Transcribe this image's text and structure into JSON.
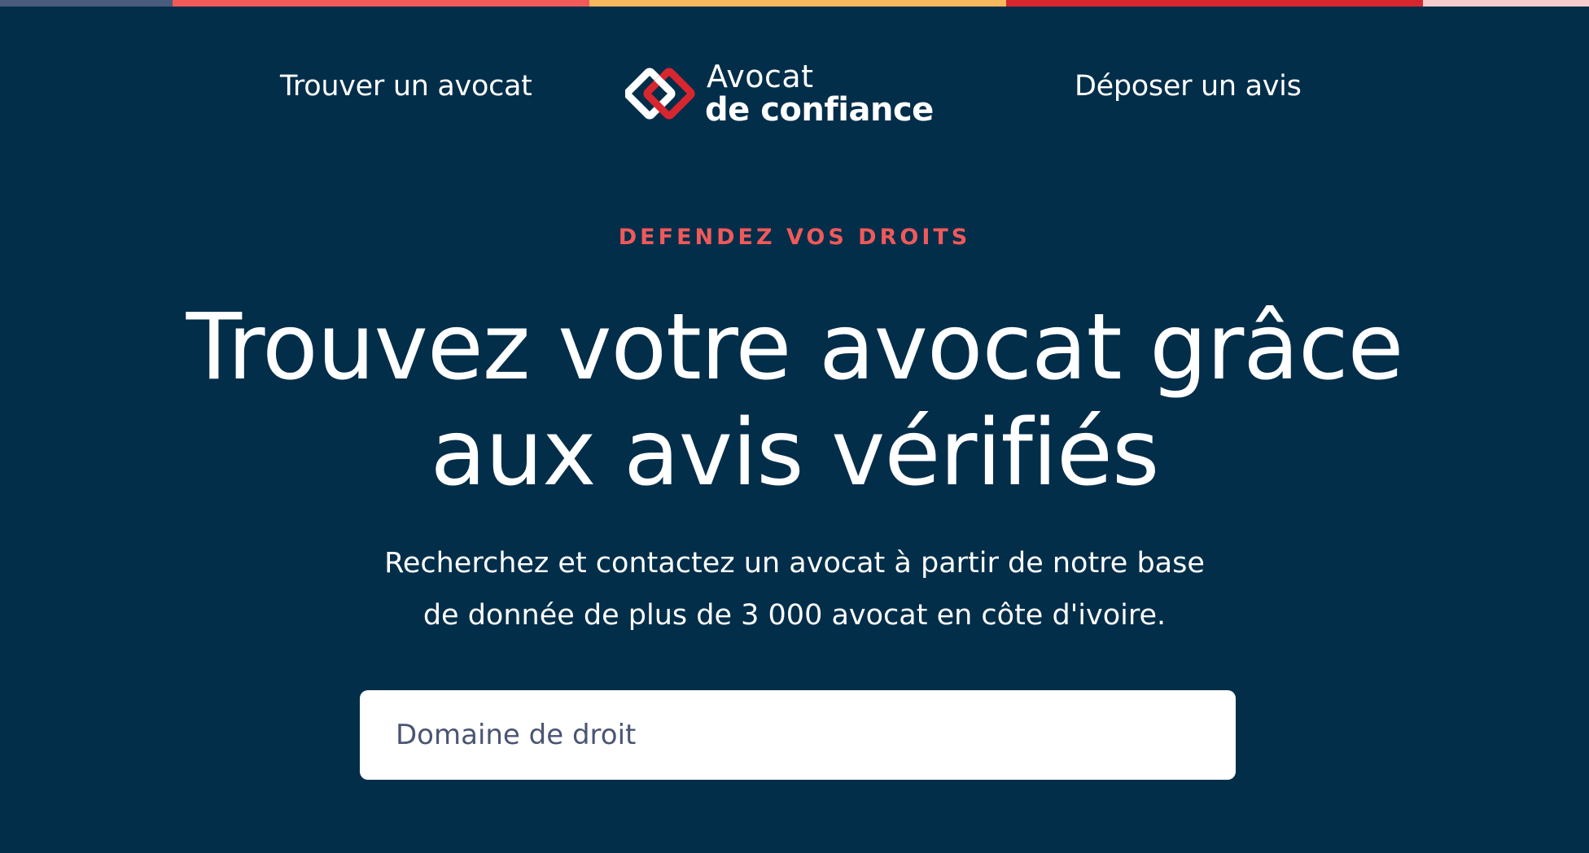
{
  "header": {
    "nav_find_lawyer": "Trouver un avocat",
    "nav_post_review": "Déposer un avis",
    "logo": {
      "line1": "Avocat",
      "line2": "de confiance"
    }
  },
  "hero": {
    "eyebrow": "DEFENDEZ VOS DROITS",
    "headline_line1": "Trouvez votre avocat grâce",
    "headline_line2": "aux avis vérifiés",
    "subtitle_line1": "Recherchez et contactez un avocat à partir de notre base",
    "subtitle_line2": "de donnée de plus de 3 000 avocat en côte d'ivoire."
  },
  "search": {
    "placeholder": "Domaine de droit"
  },
  "colors": {
    "background": "#022e4a",
    "accent_red": "#f0595a",
    "brand_red": "#d8262f",
    "strip": [
      "#4a5c7d",
      "#f25a5a",
      "#f7b85e",
      "#d8262f",
      "#f6cccc"
    ]
  }
}
